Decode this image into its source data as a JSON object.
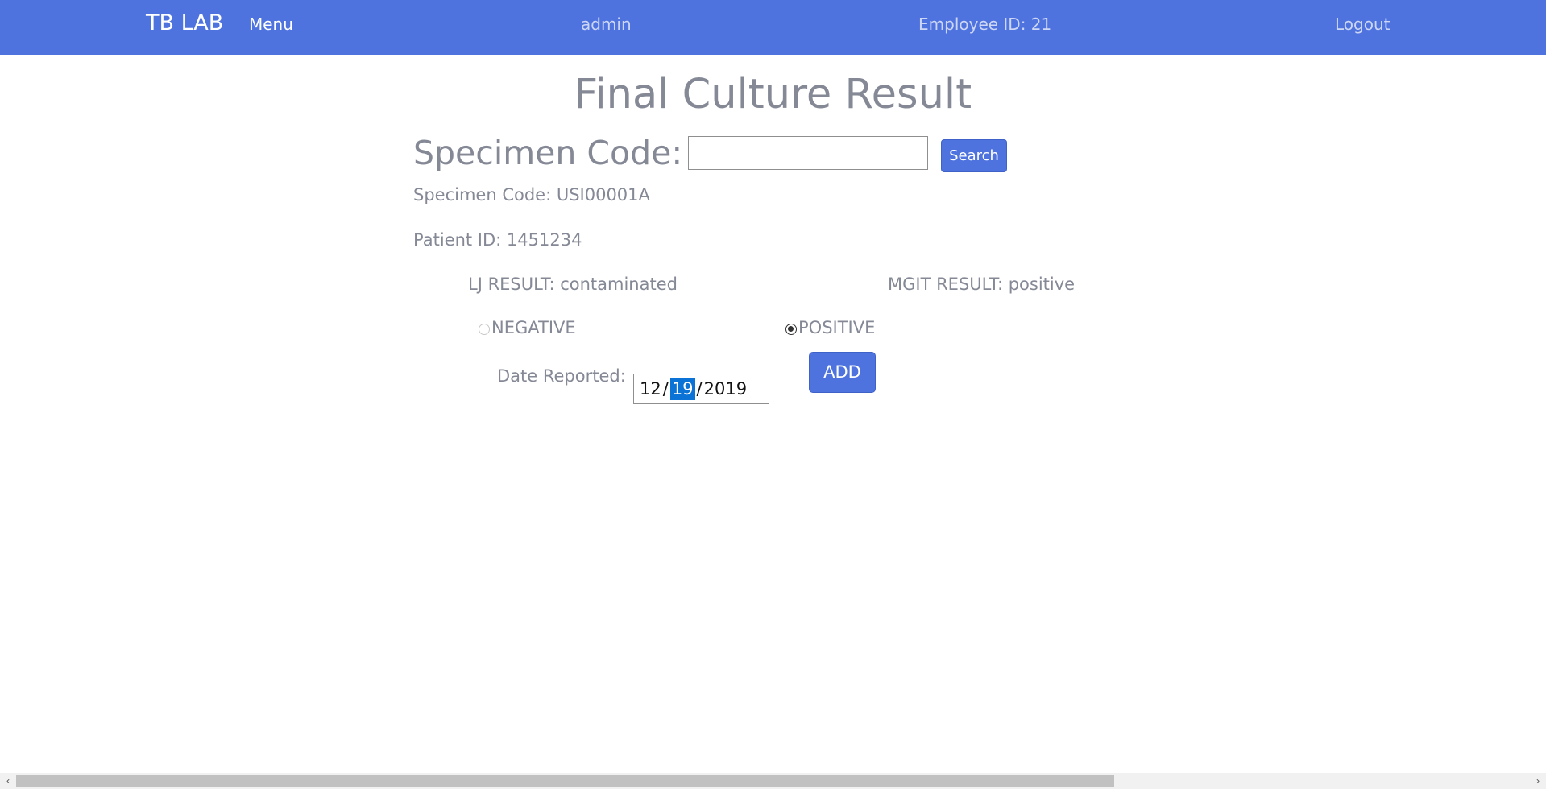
{
  "navbar": {
    "brand": "TB LAB",
    "menu_label": "Menu",
    "username": "admin",
    "employee_id": "Employee ID: 21",
    "logout_label": "Logout",
    "background_color": "#4e73df"
  },
  "main": {
    "title": "Final Culture Result",
    "search": {
      "heading": "Specimen Code:",
      "input_value": "",
      "button_label": "Search"
    },
    "specimen_code_text": "Specimen Code: USI00001A",
    "patient_id_text": "Patient ID: 1451234",
    "lj_result_text": "LJ RESULT: contaminated",
    "mgit_result_text": "MGIT RESULT: positive",
    "result_options": [
      {
        "label": "NEGATIVE",
        "checked": false
      },
      {
        "label": "POSITIVE",
        "checked": true
      }
    ],
    "date": {
      "label": "Date Reported:",
      "month": "12",
      "day": "19",
      "year": "2019",
      "separator": "/"
    },
    "add_button_label": "ADD"
  },
  "scrollbar": {
    "left_arrow_glyph": "‹",
    "right_arrow_glyph": "›"
  },
  "accent_color": "#4e73df",
  "selection_color": "#0b72d6"
}
